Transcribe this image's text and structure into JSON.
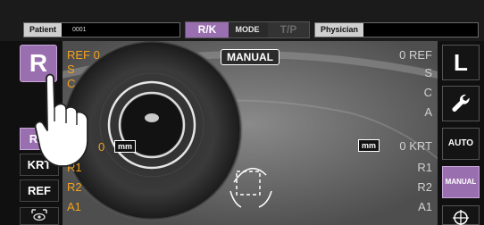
{
  "header": {
    "patient_label": "Patient",
    "patient_id": "0001",
    "mode_rk": "R/K",
    "mode_label": "MODE",
    "mode_tp": "T/P",
    "physician_label": "Physician"
  },
  "left": {
    "eye_button": "R",
    "buttons": [
      {
        "label": "R/K",
        "active": true
      },
      {
        "label": "KRT",
        "active": false
      },
      {
        "label": "REF",
        "active": false
      }
    ],
    "bottom_icon": "eye-scan-icon"
  },
  "right": {
    "eye_button": "L",
    "tools_icon": "wrench-icon",
    "auto_label": "AUTO",
    "manual_label": "MANUAL",
    "bottom_icon": "target-icon"
  },
  "overlay": {
    "manual_badge": "MANUAL",
    "left_ref": {
      "label": "REF",
      "count": "0",
      "rows": [
        "S",
        "C"
      ]
    },
    "left_krt": {
      "label": "KRT",
      "count": "0",
      "unit": "mm",
      "rows": [
        "R1",
        "R2",
        "A1"
      ]
    },
    "right_ref": {
      "label": "REF",
      "count": "0",
      "rows": [
        "S",
        "C",
        "A"
      ]
    },
    "right_krt": {
      "label": "KRT",
      "count": "0",
      "unit": "mm",
      "rows": [
        "R1",
        "R2",
        "A1"
      ]
    }
  },
  "colors": {
    "accent": "#9a6fb0",
    "readout_orange": "#f4a11c"
  }
}
